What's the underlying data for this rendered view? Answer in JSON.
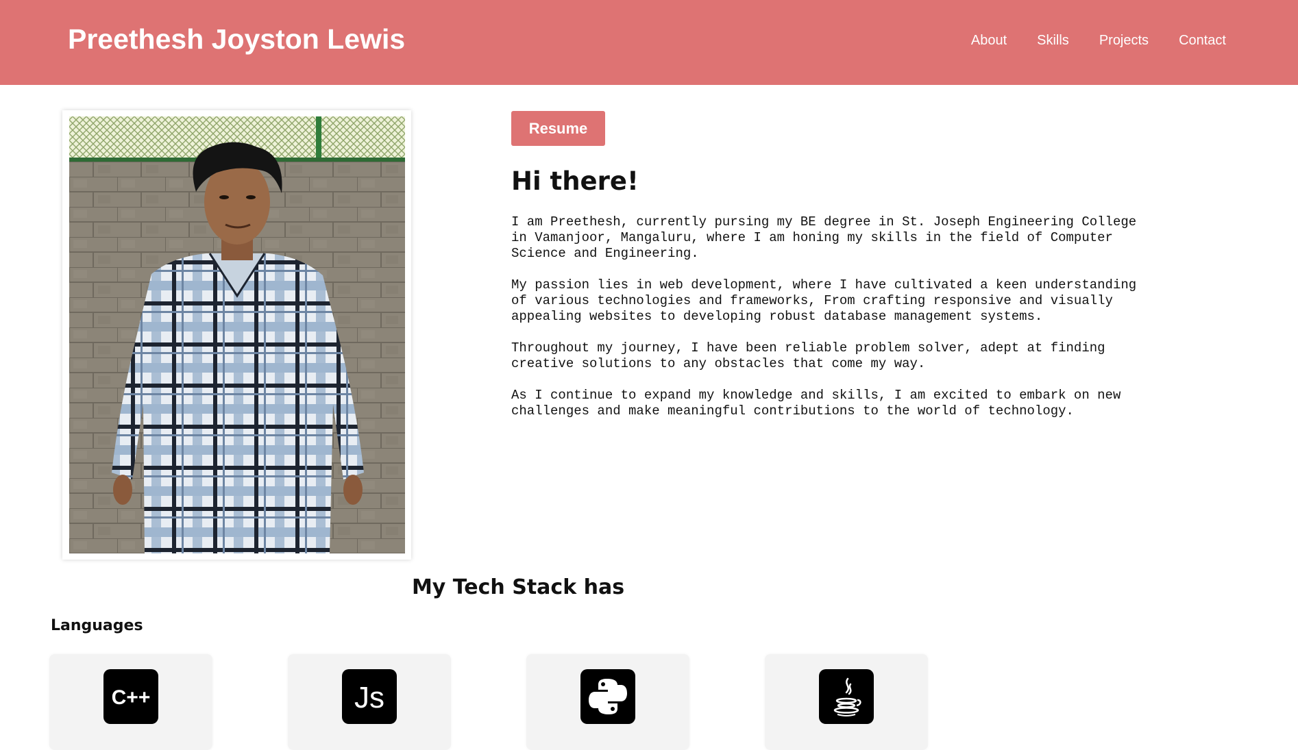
{
  "header": {
    "title": "Preethesh Joyston Lewis",
    "nav": [
      {
        "label": "About"
      },
      {
        "label": "Skills"
      },
      {
        "label": "Projects"
      },
      {
        "label": "Contact"
      }
    ]
  },
  "hero": {
    "resume_label": "Resume",
    "greeting": "Hi there!",
    "paragraphs": [
      "I am Preethesh, currently pursing my BE degree in St. Joseph Engineering College in Vamanjoor, Mangaluru, where I am honing my skills in the field of Computer Science and Engineering.",
      "My passion lies in web development, where I have cultivated a keen understanding of various technologies and frameworks, From crafting responsive and visually appealing websites to developing robust database management systems.",
      "Throughout my journey, I have been reliable problem solver, adept at finding creative solutions to any obstacles that come my way.",
      "As I continue to expand my knowledge and skills, I am excited to embark on new challenges and make meaningful contributions to the world of technology."
    ]
  },
  "tech_stack": {
    "title": "My Tech Stack has",
    "languages_heading": "Languages",
    "languages": [
      {
        "icon": "cpp-icon",
        "text": "C++"
      },
      {
        "icon": "javascript-icon",
        "text": "Js"
      },
      {
        "icon": "python-icon"
      },
      {
        "icon": "java-icon"
      }
    ]
  },
  "colors": {
    "accent": "#de7373",
    "card_bg": "#f3f3f3",
    "icon_bg": "#000000"
  }
}
